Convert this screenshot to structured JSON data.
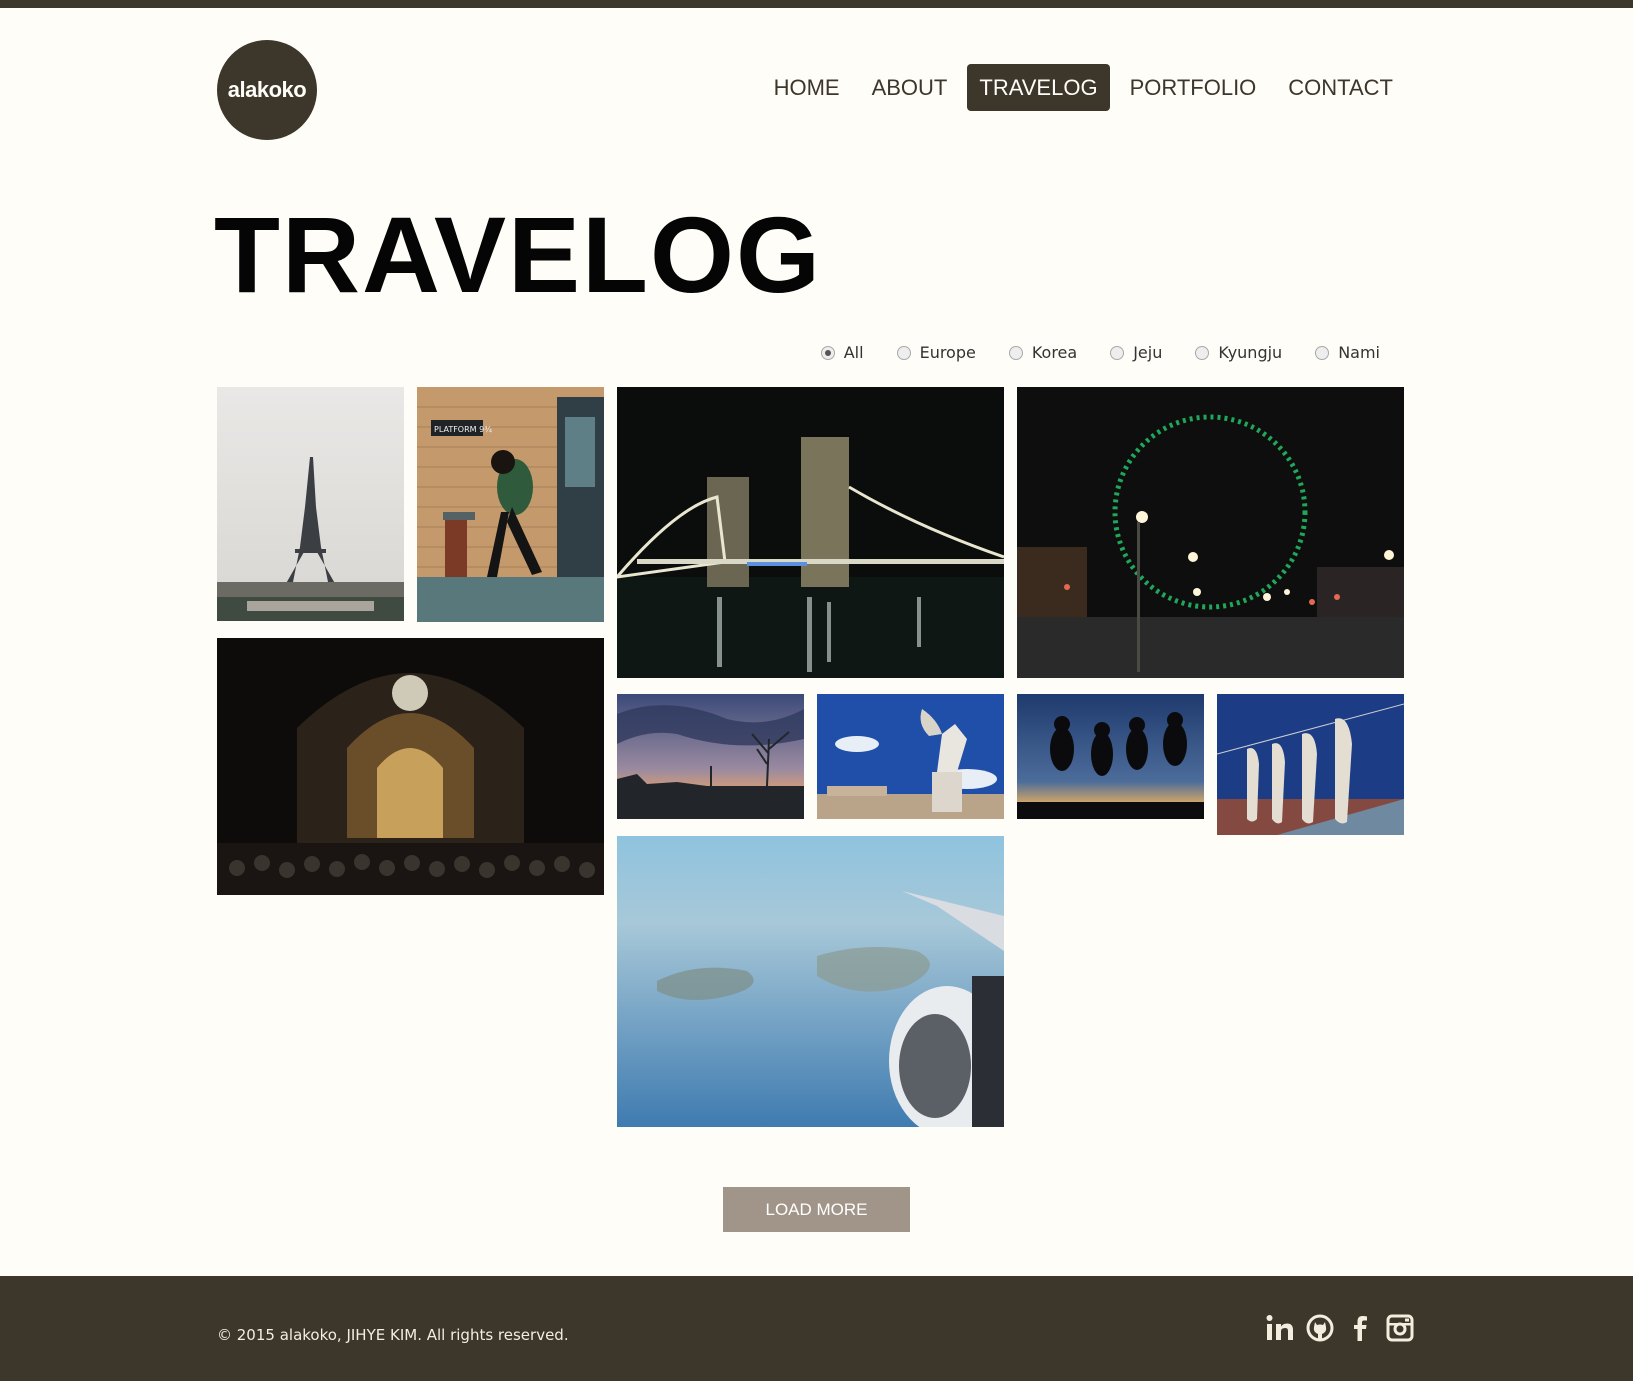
{
  "logo": {
    "text": "alakoko"
  },
  "nav": {
    "items": [
      {
        "label": "HOME"
      },
      {
        "label": "ABOUT"
      },
      {
        "label": "TRAVELOG",
        "active": true
      },
      {
        "label": "PORTFOLIO"
      },
      {
        "label": "CONTACT"
      }
    ]
  },
  "page": {
    "title": "TRAVELOG"
  },
  "filters": {
    "selected": "All",
    "options": [
      {
        "label": "All",
        "checked": true
      },
      {
        "label": "Europe",
        "checked": false
      },
      {
        "label": "Korea",
        "checked": false
      },
      {
        "label": "Jeju",
        "checked": false
      },
      {
        "label": "Kyungju",
        "checked": false
      },
      {
        "label": "Nami",
        "checked": false
      }
    ]
  },
  "gallery": {
    "photos": [
      {
        "subject": "eiffel-tower"
      },
      {
        "subject": "platform-nine-three-quarters",
        "sign": "PLATFORM 9¾"
      },
      {
        "subject": "tower-bridge-night"
      },
      {
        "subject": "london-eye-night"
      },
      {
        "subject": "cathedral-interior"
      },
      {
        "subject": "sunset-park"
      },
      {
        "subject": "angel-statue"
      },
      {
        "subject": "jumping-silhouettes"
      },
      {
        "subject": "drying-squid"
      },
      {
        "subject": "airplane-wing-sky"
      }
    ]
  },
  "load_more": {
    "label": "LOAD MORE"
  },
  "footer": {
    "copyright": "© 2015 alakoko, JIHYE KIM. All rights reserved.",
    "social": [
      {
        "icon": "linkedin-icon",
        "glyph": "in"
      },
      {
        "icon": "github-icon"
      },
      {
        "icon": "facebook-icon",
        "glyph": "f"
      },
      {
        "icon": "instagram-icon"
      }
    ]
  },
  "colors": {
    "primary": "#3d362b",
    "background": "#fefdf8",
    "button": "#a1958a"
  }
}
